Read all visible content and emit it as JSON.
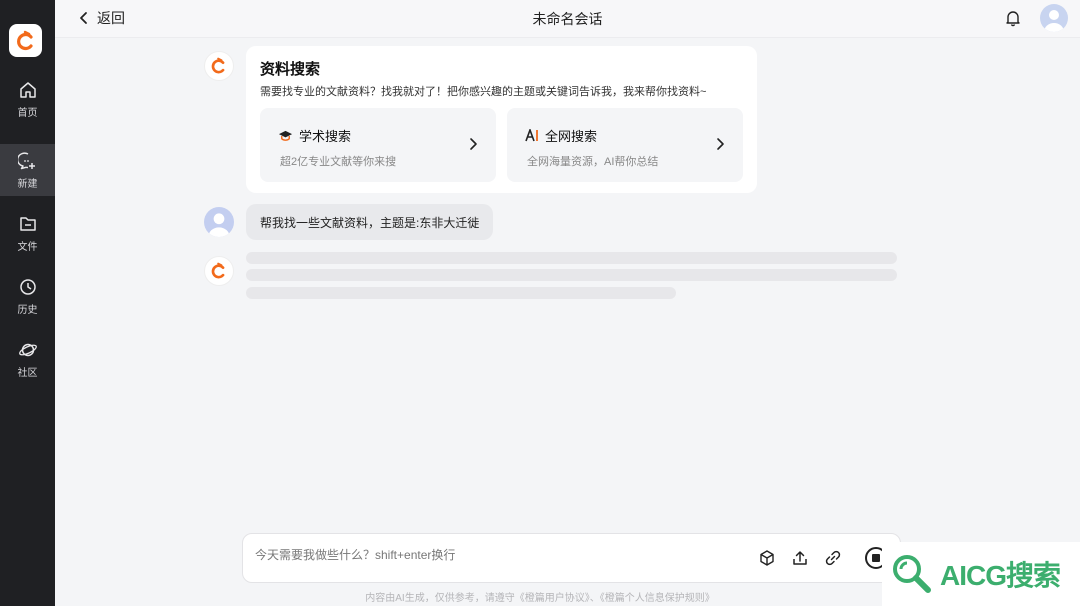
{
  "sidebar": {
    "items": [
      {
        "label": "首页",
        "icon": "home-icon"
      },
      {
        "label": "新建",
        "icon": "new-chat-icon",
        "active": true
      },
      {
        "label": "文件",
        "icon": "file-icon"
      },
      {
        "label": "历史",
        "icon": "clock-icon"
      },
      {
        "label": "社区",
        "icon": "planet-icon"
      }
    ]
  },
  "header": {
    "back_label": "返回",
    "title": "未命名会话"
  },
  "card": {
    "title": "资料搜索",
    "desc": "需要找专业的文献资料？找我就对了！把你感兴趣的主题或关键词告诉我，我来帮你找资料~",
    "options": [
      {
        "title": "学术搜索",
        "desc": "超2亿专业文献等你来搜",
        "icon": "graduation-cap-icon"
      },
      {
        "title": "全网搜索",
        "desc": "全网海量资源，AI帮你总结",
        "icon": "ai-icon"
      }
    ]
  },
  "user_message": "帮我找一些文献资料，主题是:东非大迁徙",
  "input": {
    "placeholder": "今天需要我做些什么？shift+enter换行"
  },
  "footer": "内容由AI生成，仅供参考，请遵守《橙篇用户协议》、《橙篇个人信息保护规则》",
  "watermark": "AICG搜索",
  "colors": {
    "accent": "#f26a1b",
    "sidebar_bg": "#1f2023",
    "watermark_green": "#3cae6e"
  }
}
